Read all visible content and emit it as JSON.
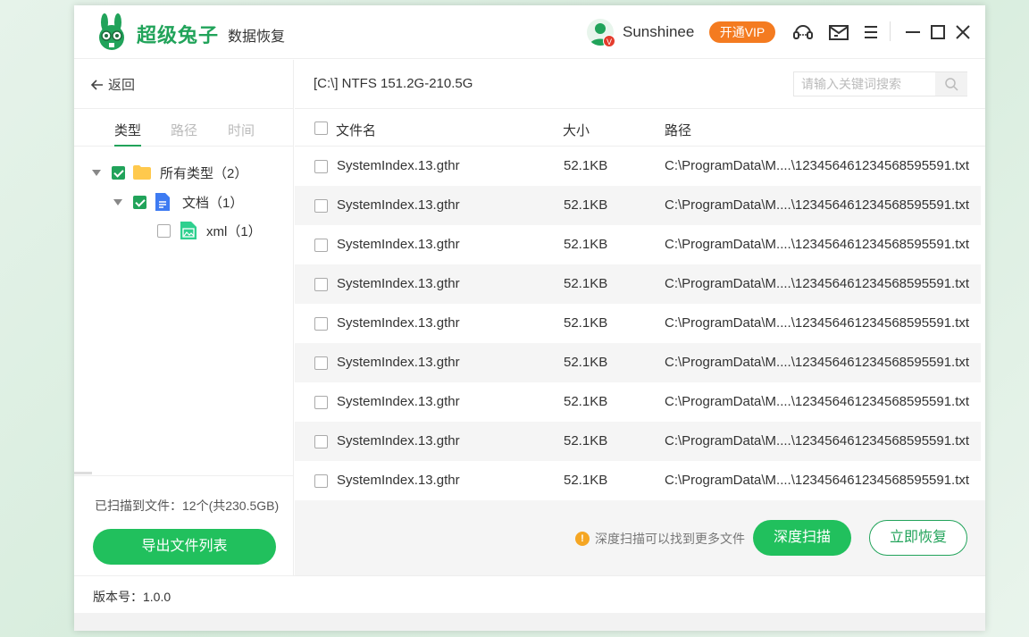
{
  "app": {
    "brand": "超级兔子",
    "subtitle": "数据恢复",
    "username": "Sunshinee",
    "vip_badge": "V",
    "vip_button": "开通VIP"
  },
  "colors": {
    "accent": "#21c05d",
    "brand_green": "#21a35a",
    "vip_orange": "#f47b20"
  },
  "left": {
    "back_label": "返回",
    "tabs": [
      {
        "label": "类型",
        "active": true
      },
      {
        "label": "路径",
        "active": false
      },
      {
        "label": "时间",
        "active": false
      }
    ],
    "tree": [
      {
        "label": "所有类型（2）",
        "checked": true,
        "icon": "folder-icon"
      },
      {
        "label": "文档（1）",
        "checked": true,
        "icon": "document-icon"
      },
      {
        "label": "xml（1）",
        "checked": false,
        "icon": "image-file-icon"
      }
    ],
    "scanned_text": "已扫描到文件：12个(共230.5GB)",
    "export_button": "导出文件列表"
  },
  "right": {
    "drive_label": "[C:\\] NTFS 151.2G-210.5G",
    "search_placeholder": "请输入关键词搜索",
    "headers": {
      "name": "文件名",
      "size": "大小",
      "path": "路径"
    },
    "rows": [
      {
        "name": "SystemIndex.13.gthr",
        "size": "52.1KB",
        "path": "C:\\ProgramData\\M....\\12345646123456859 5591.txt"
      },
      {
        "name": "SystemIndex.13.gthr",
        "size": "52.1KB",
        "path": "C:\\ProgramData\\M....\\123456461234568595591.txt"
      },
      {
        "name": "SystemIndex.13.gthr",
        "size": "52.1KB",
        "path": "C:\\ProgramData\\M....\\123456461234568595591.txt"
      },
      {
        "name": "SystemIndex.13.gthr",
        "size": "52.1KB",
        "path": "C:\\ProgramData\\M....\\123456461234568595591.txt"
      },
      {
        "name": "SystemIndex.13.gthr",
        "size": "52.1KB",
        "path": "C:\\ProgramData\\M....\\123456461234568595591.txt"
      },
      {
        "name": "SystemIndex.13.gthr",
        "size": "52.1KB",
        "path": "C:\\ProgramData\\M....\\123456461234568595591.txt"
      },
      {
        "name": "SystemIndex.13.gthr",
        "size": "52.1KB",
        "path": "C:\\ProgramData\\M....\\123456461234568595591.txt"
      },
      {
        "name": "SystemIndex.13.gthr",
        "size": "52.1KB",
        "path": "C:\\ProgramData\\M....\\123456461234568595591.txt"
      },
      {
        "name": "SystemIndex.13.gthr",
        "size": "52.1KB",
        "path": "C:\\ProgramData\\M....\\123456461234568595591.txt"
      }
    ],
    "tip_text": "深度扫描可以找到更多文件",
    "deep_scan_button": "深度扫描",
    "recover_button": "立即恢复"
  },
  "footer": {
    "version": "版本号：1.0.0"
  }
}
